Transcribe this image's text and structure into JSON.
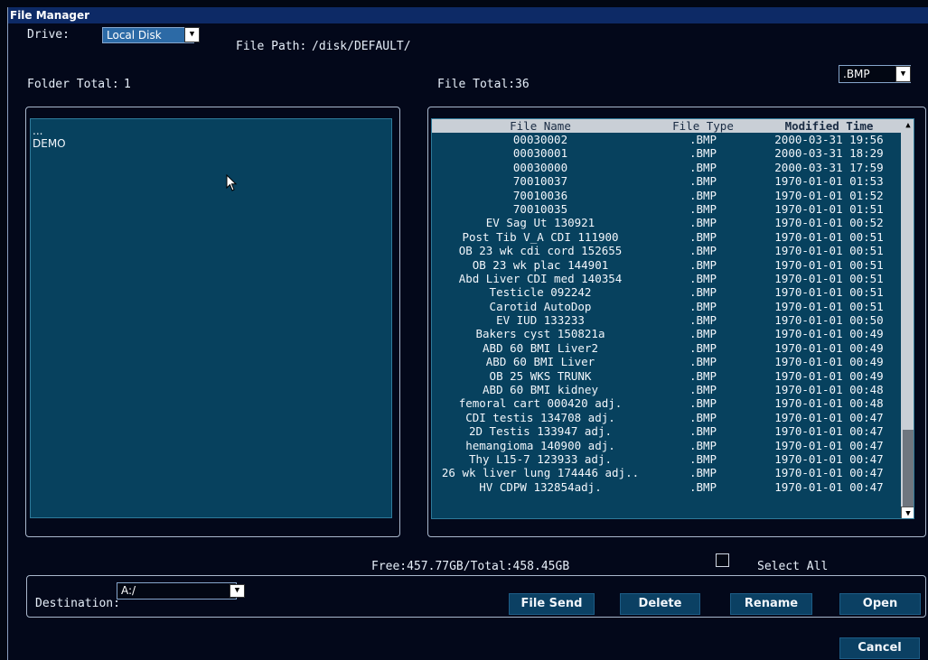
{
  "window": {
    "title": "File Manager"
  },
  "drive": {
    "label": "Drive:",
    "value": "Local Disk"
  },
  "file_path": {
    "label": "File Path:",
    "value": "/disk/DEFAULT/"
  },
  "folder_total": {
    "label": "Folder Total:",
    "value": "1"
  },
  "file_total": {
    "label": "File Total:",
    "value": "36"
  },
  "filter": {
    "value": ".BMP"
  },
  "folders": [
    {
      "name": "..."
    },
    {
      "name": "DEMO"
    }
  ],
  "file_table": {
    "columns": [
      "File Name",
      "File Type",
      "Modified Time"
    ],
    "rows": [
      {
        "name": "00030002",
        "type": ".BMP",
        "time": "2000-03-31 19:56"
      },
      {
        "name": "00030001",
        "type": ".BMP",
        "time": "2000-03-31 18:29"
      },
      {
        "name": "00030000",
        "type": ".BMP",
        "time": "2000-03-31 17:59"
      },
      {
        "name": "70010037",
        "type": ".BMP",
        "time": "1970-01-01 01:53"
      },
      {
        "name": "70010036",
        "type": ".BMP",
        "time": "1970-01-01 01:52"
      },
      {
        "name": "70010035",
        "type": ".BMP",
        "time": "1970-01-01 01:51"
      },
      {
        "name": "EV Sag Ut 130921",
        "type": ".BMP",
        "time": "1970-01-01 00:52"
      },
      {
        "name": "Post Tib V_A CDI 111900",
        "type": ".BMP",
        "time": "1970-01-01 00:51"
      },
      {
        "name": "OB 23 wk cdi cord 152655",
        "type": ".BMP",
        "time": "1970-01-01 00:51"
      },
      {
        "name": "OB 23 wk plac 144901",
        "type": ".BMP",
        "time": "1970-01-01 00:51"
      },
      {
        "name": "Abd Liver CDI med 140354",
        "type": ".BMP",
        "time": "1970-01-01 00:51"
      },
      {
        "name": "Testicle 092242",
        "type": ".BMP",
        "time": "1970-01-01 00:51"
      },
      {
        "name": "Carotid AutoDop",
        "type": ".BMP",
        "time": "1970-01-01 00:51"
      },
      {
        "name": "EV IUD 133233",
        "type": ".BMP",
        "time": "1970-01-01 00:50"
      },
      {
        "name": "Bakers cyst 150821a",
        "type": ".BMP",
        "time": "1970-01-01 00:49"
      },
      {
        "name": "ABD 60 BMI Liver2",
        "type": ".BMP",
        "time": "1970-01-01 00:49"
      },
      {
        "name": "ABD 60 BMI Liver",
        "type": ".BMP",
        "time": "1970-01-01 00:49"
      },
      {
        "name": "OB 25 WKS TRUNK",
        "type": ".BMP",
        "time": "1970-01-01 00:49"
      },
      {
        "name": "ABD 60 BMI kidney",
        "type": ".BMP",
        "time": "1970-01-01 00:48"
      },
      {
        "name": "femoral cart 000420 adj.",
        "type": ".BMP",
        "time": "1970-01-01 00:48"
      },
      {
        "name": "CDI testis 134708 adj.",
        "type": ".BMP",
        "time": "1970-01-01 00:47"
      },
      {
        "name": "2D Testis 133947 adj.",
        "type": ".BMP",
        "time": "1970-01-01 00:47"
      },
      {
        "name": "hemangioma 140900 adj.",
        "type": ".BMP",
        "time": "1970-01-01 00:47"
      },
      {
        "name": "Thy L15-7 123933 adj.",
        "type": ".BMP",
        "time": "1970-01-01 00:47"
      },
      {
        "name": "26 wk liver lung 174446 adj..",
        "type": ".BMP",
        "time": "1970-01-01 00:47"
      },
      {
        "name": "HV CDPW 132854adj.",
        "type": ".BMP",
        "time": "1970-01-01 00:47"
      }
    ]
  },
  "storage": {
    "text": "Free:457.77GB/Total:458.45GB"
  },
  "select_all": {
    "label": "Select All"
  },
  "destination": {
    "label": "Destination:",
    "value": "A:/"
  },
  "buttons": {
    "file_send": "File Send",
    "delete": "Delete",
    "rename": "Rename",
    "open": "Open",
    "cancel": "Cancel"
  },
  "icons": {
    "dropdown": "triangle-down-icon",
    "scroll_up": "triangle-up-icon",
    "scroll_down": "triangle-down-icon",
    "cursor": "mouse-pointer-icon"
  }
}
